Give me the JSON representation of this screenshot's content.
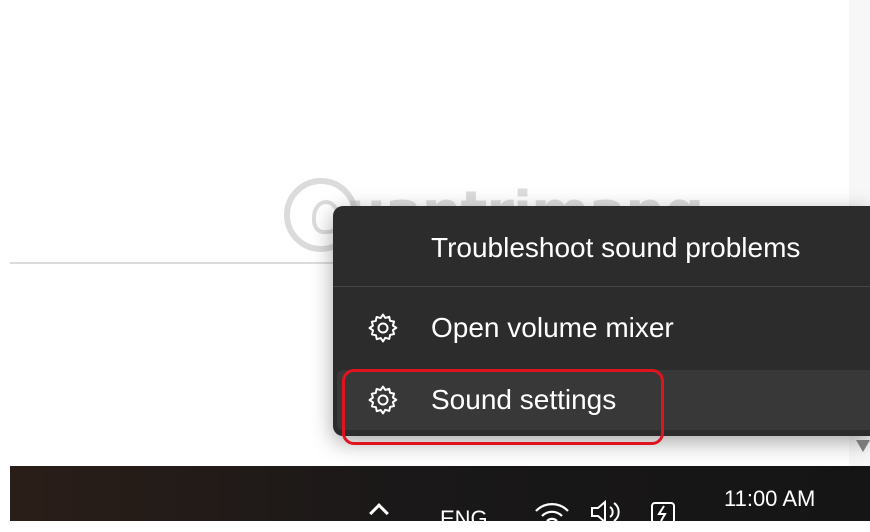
{
  "watermark": {
    "text": "uantrimang"
  },
  "context_menu": {
    "items": [
      {
        "label": "Troubleshoot sound problems",
        "icon": "none"
      },
      {
        "label": "Open volume mixer",
        "icon": "gear-icon"
      },
      {
        "label": "Sound settings",
        "icon": "gear-icon"
      }
    ],
    "highlight_color": "#e0141e",
    "background": "#2c2c2c"
  },
  "taskbar": {
    "language": "ENG",
    "time": "11:00 AM",
    "tray_icons": [
      "chevron-up-icon",
      "wifi-icon",
      "volume-icon",
      "battery-icon"
    ]
  }
}
